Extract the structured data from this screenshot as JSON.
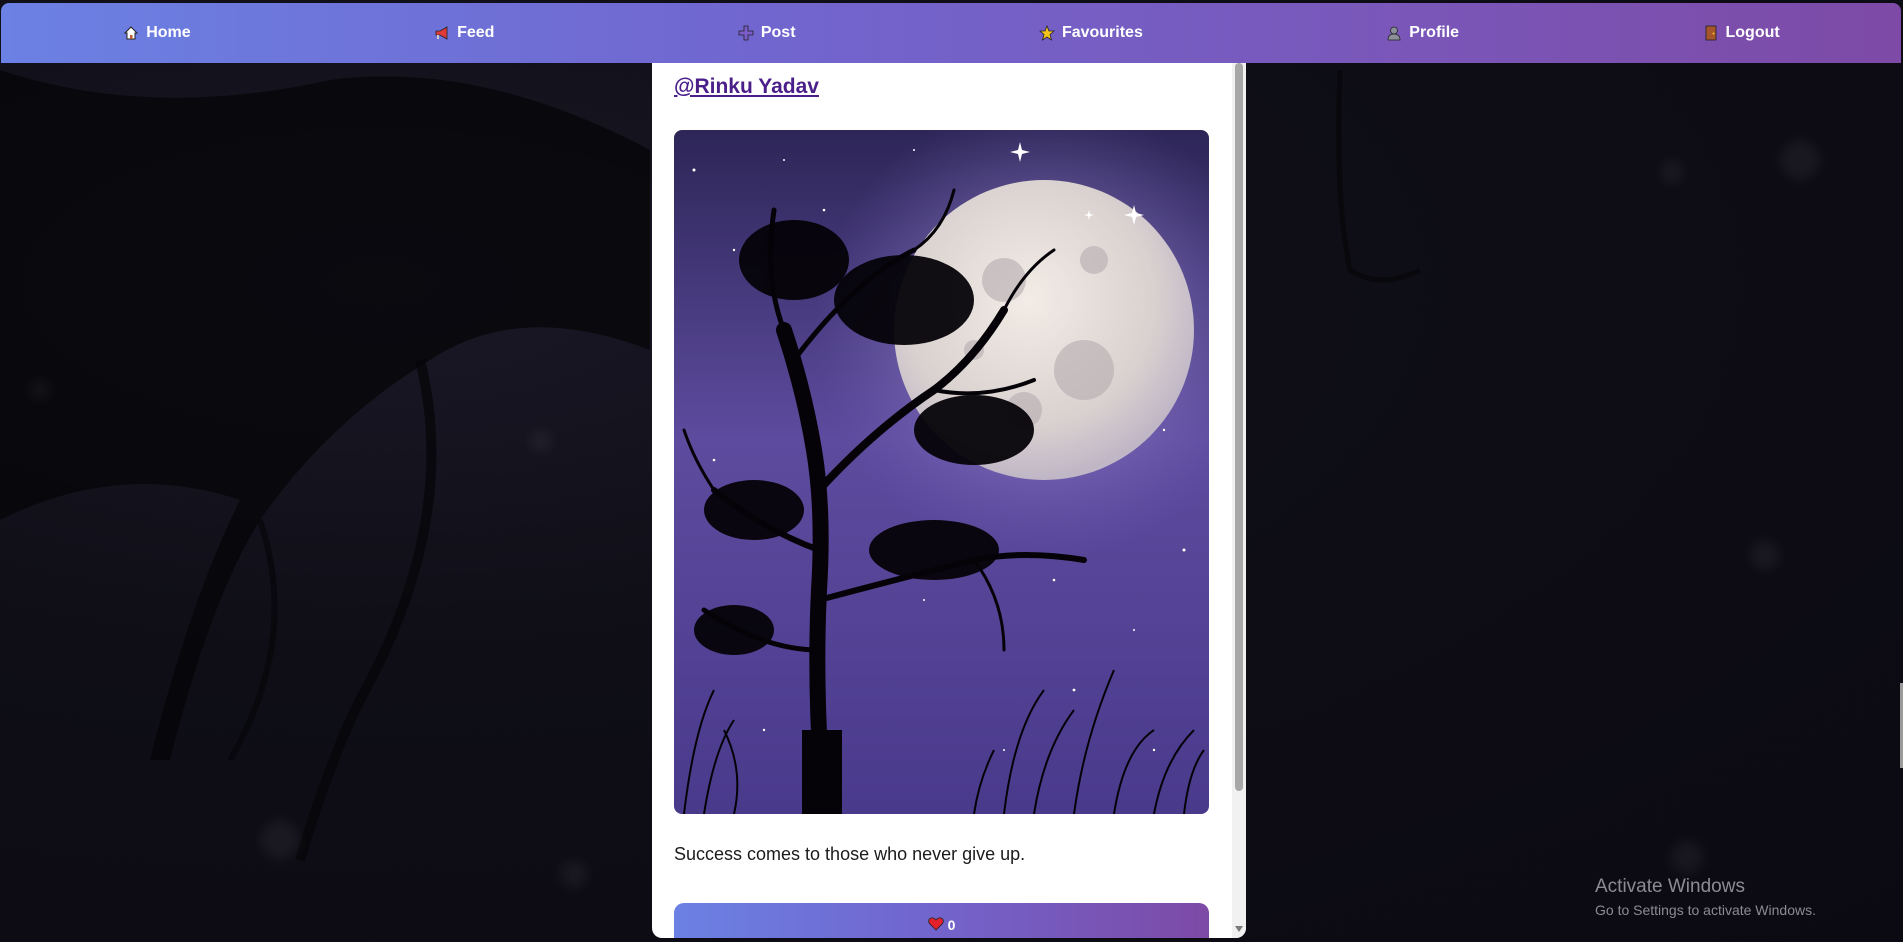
{
  "nav": {
    "items": [
      {
        "label": "Home",
        "icon": "home-icon"
      },
      {
        "label": "Feed",
        "icon": "megaphone-icon"
      },
      {
        "label": "Post",
        "icon": "plus-icon"
      },
      {
        "label": "Favourites",
        "icon": "star-icon"
      },
      {
        "label": "Profile",
        "icon": "user-icon"
      },
      {
        "label": "Logout",
        "icon": "door-icon"
      }
    ]
  },
  "post": {
    "username": "@Rinku Yadav",
    "image_icon": "moon-tree-image",
    "caption": "Success comes to those who never give up.",
    "likes": "0",
    "like_icon": "heart-icon"
  },
  "watermark": {
    "title": "Activate Windows",
    "subtitle": "Go to Settings to activate Windows."
  },
  "colors": {
    "nav_start": "#6b81e3",
    "nav_end": "#7d4aa6",
    "username": "#4b1f8a"
  }
}
